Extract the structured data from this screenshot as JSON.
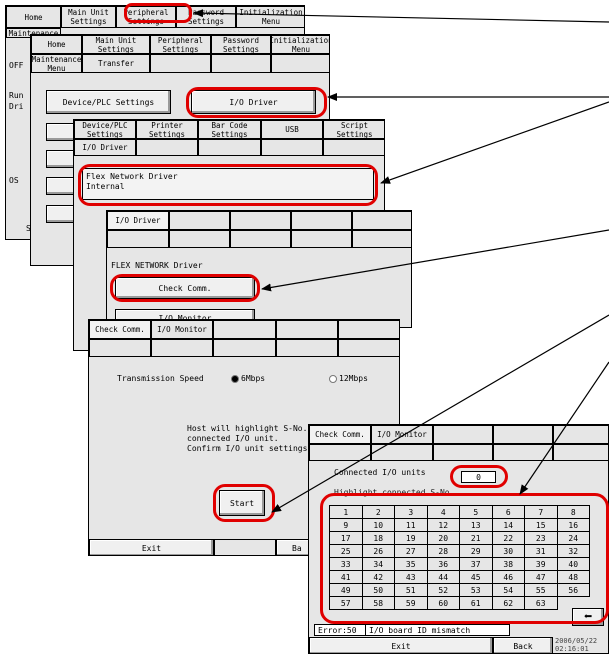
{
  "s1": {
    "tabs": [
      "Home",
      "Main Unit\nSettings",
      "Peripheral\nSettings",
      "Password\nSettings",
      "Initialization\nMenu"
    ],
    "row2_tab": "Maintenance",
    "side_labels": [
      "OFF",
      "Run",
      "Dri",
      "OS"
    ],
    "save_label": "Save"
  },
  "s2": {
    "tabs": [
      "Home",
      "Main Unit\nSettings",
      "Peripheral\nSettings",
      "Password\nSettings",
      "Initialization\nMenu"
    ],
    "row2": [
      "Maintenance\nMenu",
      "Transfer"
    ],
    "device_plc_button": "Device/PLC Settings",
    "io_driver_button": "I/O Driver"
  },
  "s3": {
    "tabs": [
      "Device/PLC\nSettings",
      "Printer\nSettings",
      "Bar Code\nSettings",
      "USB",
      "Script\nSettings"
    ],
    "row2": [
      "I/O Driver"
    ],
    "driver_text": "Flex Network Driver\nInternal"
  },
  "s4": {
    "tabs": [
      "I/O Driver"
    ],
    "driver_title": "FLEX NETWORK Driver",
    "check_comm_button": "Check Comm.",
    "io_monitor_button": "I/O Monitor"
  },
  "s5": {
    "tabs": [
      "Check Comm.",
      "I/O Monitor"
    ],
    "transmission_label": "Transmission Speed",
    "speed_options": [
      "6Mbps",
      "12Mbps"
    ],
    "selected_speed": "6Mbps",
    "info_text": "Host will highlight S-No. of\nconnected I/O unit.\nConfirm I/O unit settings.",
    "start_button": "Start",
    "exit_button": "Exit",
    "back_partial": "Ba"
  },
  "s6": {
    "tabs": [
      "Check Comm.",
      "I/O Monitor"
    ],
    "connected_label": "Connected I/O units",
    "connected_value": "0",
    "highlight_label": "Highlight connected S-No.",
    "numbers": [
      "1",
      "2",
      "3",
      "4",
      "5",
      "6",
      "7",
      "8",
      "9",
      "10",
      "11",
      "12",
      "13",
      "14",
      "15",
      "16",
      "17",
      "18",
      "19",
      "20",
      "21",
      "22",
      "23",
      "24",
      "25",
      "26",
      "27",
      "28",
      "29",
      "30",
      "31",
      "32",
      "33",
      "34",
      "35",
      "36",
      "37",
      "38",
      "39",
      "40",
      "41",
      "42",
      "43",
      "44",
      "45",
      "46",
      "47",
      "48",
      "49",
      "50",
      "51",
      "52",
      "53",
      "54",
      "55",
      "56",
      "57",
      "58",
      "59",
      "60",
      "61",
      "62",
      "63"
    ],
    "error_label": "Error:50",
    "error_message": "I/O board ID mismatch",
    "exit_button": "Exit",
    "back_button": "Back",
    "datetime": "2006/05/22\n02:16:01"
  },
  "colors": {
    "highlight": "#e00000",
    "panel": "#e6e6e6"
  }
}
